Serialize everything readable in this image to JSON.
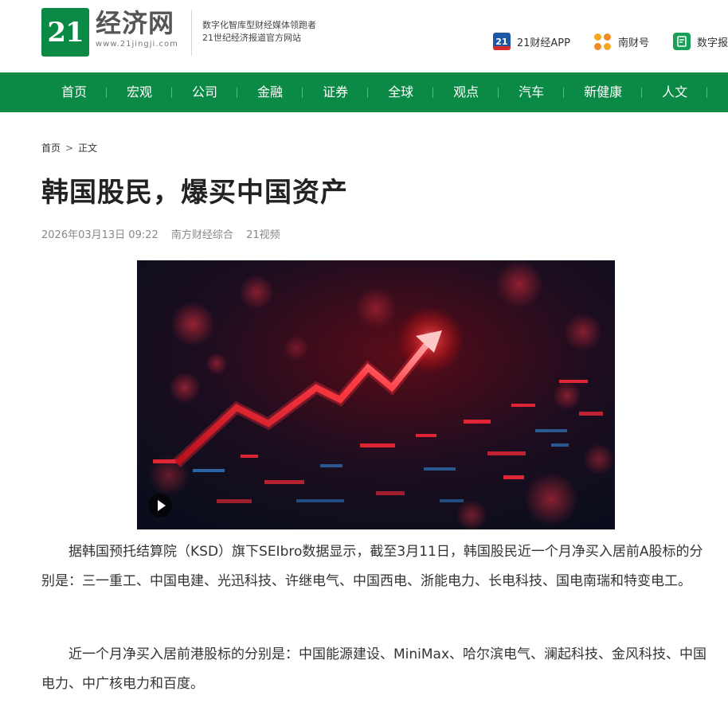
{
  "header": {
    "logo_number": "21",
    "logo_name": "经济网",
    "logo_url": "www.21jingji.com",
    "slogan_line1": "数字化智库型财经媒体领跑者",
    "slogan_line2": "21世纪经济报道官方网站",
    "links": [
      {
        "label": "21财经APP",
        "icon": "21-app-icon"
      },
      {
        "label": "南财号",
        "icon": "nancaihao-icon"
      },
      {
        "label": "数字报",
        "icon": "digital-paper-icon"
      }
    ]
  },
  "nav": {
    "items": [
      "首页",
      "宏观",
      "公司",
      "金融",
      "证券",
      "全球",
      "观点",
      "汽车",
      "新健康",
      "人文"
    ]
  },
  "breadcrumb": {
    "home": "首页",
    "separator": ">",
    "current": "正文"
  },
  "article": {
    "title": "韩国股民，爆买中国资产",
    "date": "2026年03月13日 09:22",
    "source": "南方财经综合",
    "author": "21视频",
    "paragraphs": [
      "据韩国预托结算院（KSD）旗下SEIbro数据显示，截至3月11日，韩国股民近一个月净买入居前A股标的分别是：三一重工、中国电建、光迅科技、许继电气、中国西电、浙能电力、长电科技、国电南瑞和特变电工。",
      "近一个月净买入居前港股标的分别是：中国能源建设、MiniMax、哈尔滨电气、澜起科技、金风科技、中国电力、中广核电力和百度。"
    ]
  },
  "colors": {
    "brand_green": "#0a8a45",
    "app_blue": "#1e56a6",
    "accent_red": "#ff2a3a"
  }
}
